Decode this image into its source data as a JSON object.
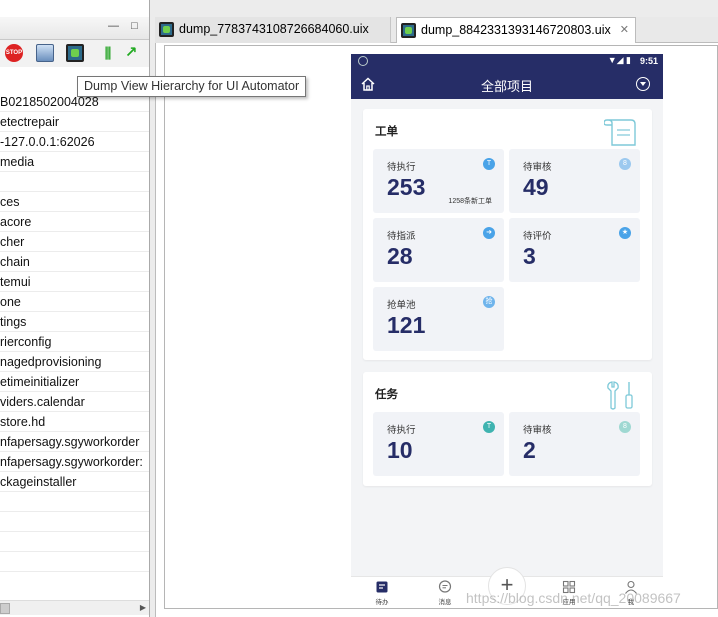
{
  "left_panel": {
    "window_buttons": {
      "minimize": "—",
      "maximize": "□"
    },
    "toolbar": {
      "stop_label": "STOP"
    },
    "tree_rows": [
      "B0218502004028",
      "etectrepair",
      "-127.0.0.1:62026",
      "media",
      "",
      "ces",
      "acore",
      "cher",
      "chain",
      "temui",
      "one",
      "tings",
      "rierconfig",
      "nagedprovisioning",
      "etimeinitializer",
      "viders.calendar",
      "store.hd",
      "nfapersagy.sgyworkorder",
      "nfapersagy.sgyworkorder:",
      "ckageinstaller",
      "",
      "",
      "",
      ""
    ]
  },
  "tooltip": {
    "text": "Dump View Hierarchy for UI Automator"
  },
  "editor": {
    "tabs": [
      {
        "label": "dump_7783743108726684060.uix",
        "active": false
      },
      {
        "label": "dump_8842331393146720803.uix",
        "active": true
      }
    ],
    "close_glyph": "✕"
  },
  "phone": {
    "status_bar": {
      "time": "9:51",
      "icons": "▼◢ ▮"
    },
    "header": {
      "title": "全部项目"
    },
    "workorder": {
      "title": "工单",
      "cards": [
        {
          "label": "待执行",
          "value": "253",
          "note": "1258条新工单",
          "badge": "T",
          "badge_color": "#4aa3e8"
        },
        {
          "label": "待审核",
          "value": "49",
          "note": "",
          "badge": "8",
          "badge_color": "#9cc9ef"
        },
        {
          "label": "待指派",
          "value": "28",
          "note": "",
          "badge": "➜",
          "badge_color": "#4aa3e8"
        },
        {
          "label": "待评价",
          "value": "3",
          "note": "",
          "badge": "★",
          "badge_color": "#4aa3e8"
        },
        {
          "label": "抢单池",
          "value": "121",
          "note": "",
          "badge": "抢",
          "badge_color": "#6fb4ec"
        }
      ]
    },
    "task": {
      "title": "任务",
      "cards": [
        {
          "label": "待执行",
          "value": "10",
          "note": "",
          "badge": "T",
          "badge_color": "#3fb3b0"
        },
        {
          "label": "待审核",
          "value": "2",
          "note": "",
          "badge": "8",
          "badge_color": "#9fd8d2"
        }
      ]
    },
    "bottom_nav": [
      {
        "label": "待办",
        "icon": "todo-icon"
      },
      {
        "label": "消息",
        "icon": "message-icon"
      },
      {
        "label": "+",
        "icon": "plus-icon"
      },
      {
        "label": "应用",
        "icon": "apps-icon"
      },
      {
        "label": "我",
        "icon": "profile-icon"
      }
    ]
  },
  "watermark": "https://blog.csdn.net/qq_20089667",
  "colors": {
    "navy": "#262d67",
    "card_bg": "#f1f3f7",
    "accent_blue": "#4aa3e8",
    "accent_teal": "#3fb3b0"
  }
}
